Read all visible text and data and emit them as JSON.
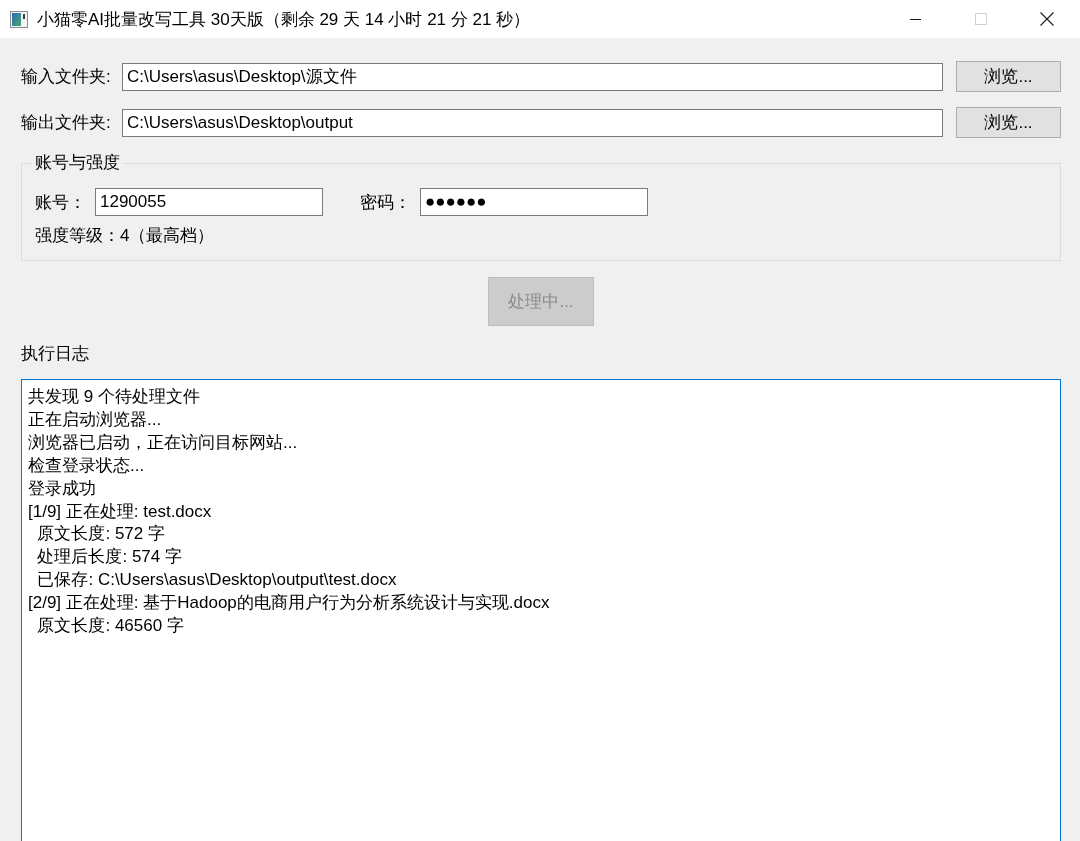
{
  "window": {
    "title": "小猫零AI批量改写工具 30天版（剩余 29 天 14 小时 21 分 21 秒）",
    "maximize_disabled": true
  },
  "folders": [
    {
      "label": "输入文件夹:",
      "value": "C:\\Users\\asus\\Desktop\\源文件",
      "button": "浏览..."
    },
    {
      "label": "输出文件夹:",
      "value": "C:\\Users\\asus\\Desktop\\output",
      "button": "浏览..."
    }
  ],
  "account_group": {
    "title": "账号与强度",
    "fields": [
      {
        "label": "账号：",
        "value": "1290055"
      },
      {
        "label": "密码：",
        "value": "●●●●●●"
      }
    ],
    "strength": "强度等级：4（最高档）"
  },
  "process_button": {
    "label": "处理中...",
    "disabled": true
  },
  "log": {
    "title": "执行日志",
    "focused": true,
    "lines": [
      "共发现 9 个待处理文件",
      "正在启动浏览器...",
      "浏览器已启动，正在访问目标网站...",
      "检查登录状态...",
      "登录成功",
      "[1/9] 正在处理: test.docx",
      "  原文长度: 572 字",
      "  处理后长度: 574 字",
      "  已保存: C:\\Users\\asus\\Desktop\\output\\test.docx",
      "[2/9] 正在处理: 基于Hadoop的电商用户行为分析系统设计与实现.docx",
      "  原文长度: 46560 字"
    ]
  }
}
